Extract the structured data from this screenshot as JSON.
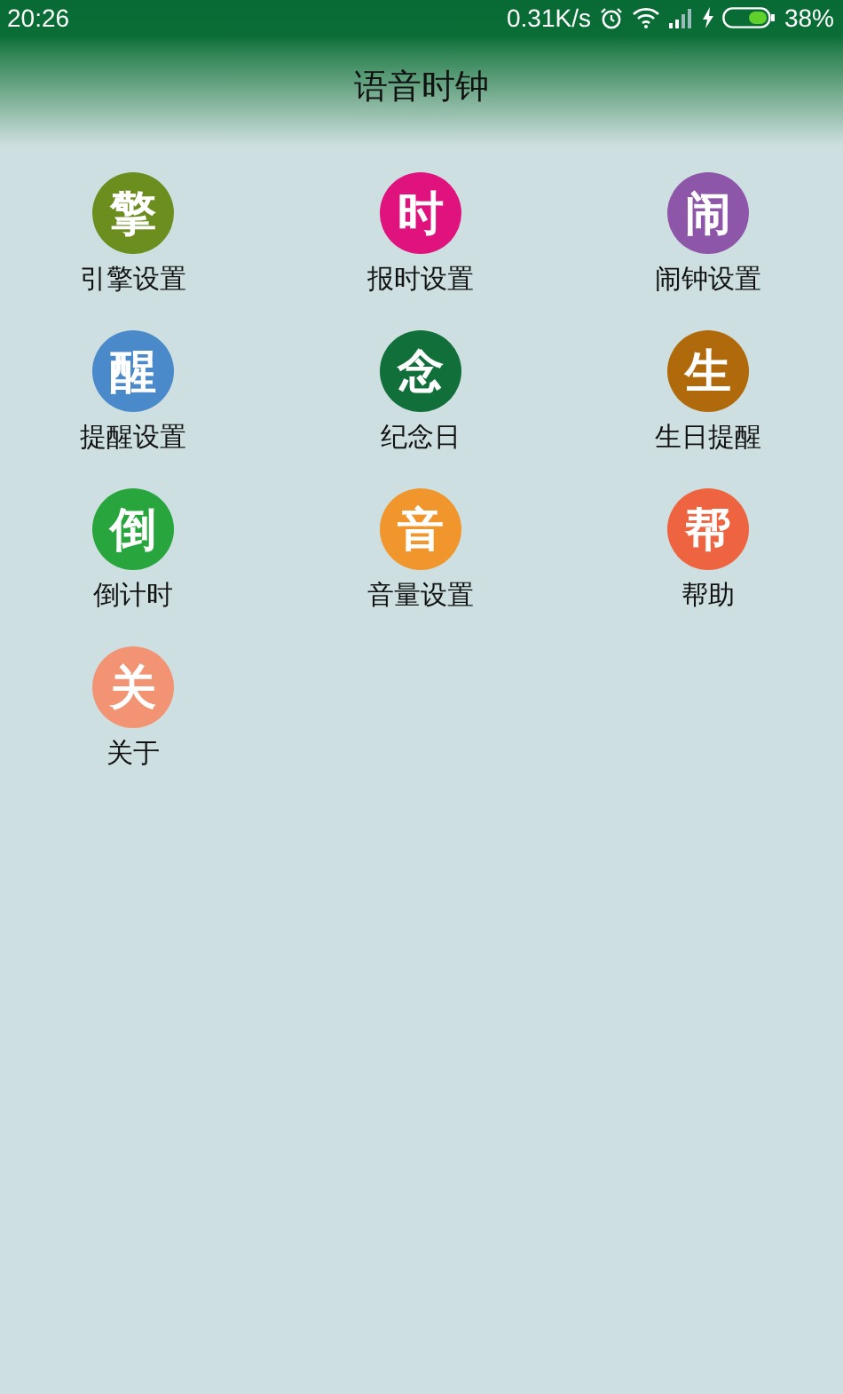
{
  "status_bar": {
    "time": "20:26",
    "net_speed": "0.31K/s",
    "battery": "38%"
  },
  "title": "语音时钟",
  "menu": [
    {
      "glyph": "擎",
      "label": "引擎设置",
      "color": "#6b8e1f"
    },
    {
      "glyph": "时",
      "label": "报时设置",
      "color": "#e0127e"
    },
    {
      "glyph": "闹",
      "label": "闹钟设置",
      "color": "#8e56a8"
    },
    {
      "glyph": "醒",
      "label": "提醒设置",
      "color": "#4a8acb"
    },
    {
      "glyph": "念",
      "label": "纪念日",
      "color": "#11703a"
    },
    {
      "glyph": "生",
      "label": "生日提醒",
      "color": "#b06a0c"
    },
    {
      "glyph": "倒",
      "label": "倒计时",
      "color": "#28a53c"
    },
    {
      "glyph": "音",
      "label": "音量设置",
      "color": "#f0962c"
    },
    {
      "glyph": "帮",
      "label": "帮助",
      "color": "#ee6440"
    },
    {
      "glyph": "关",
      "label": "关于",
      "color": "#f29474"
    }
  ]
}
